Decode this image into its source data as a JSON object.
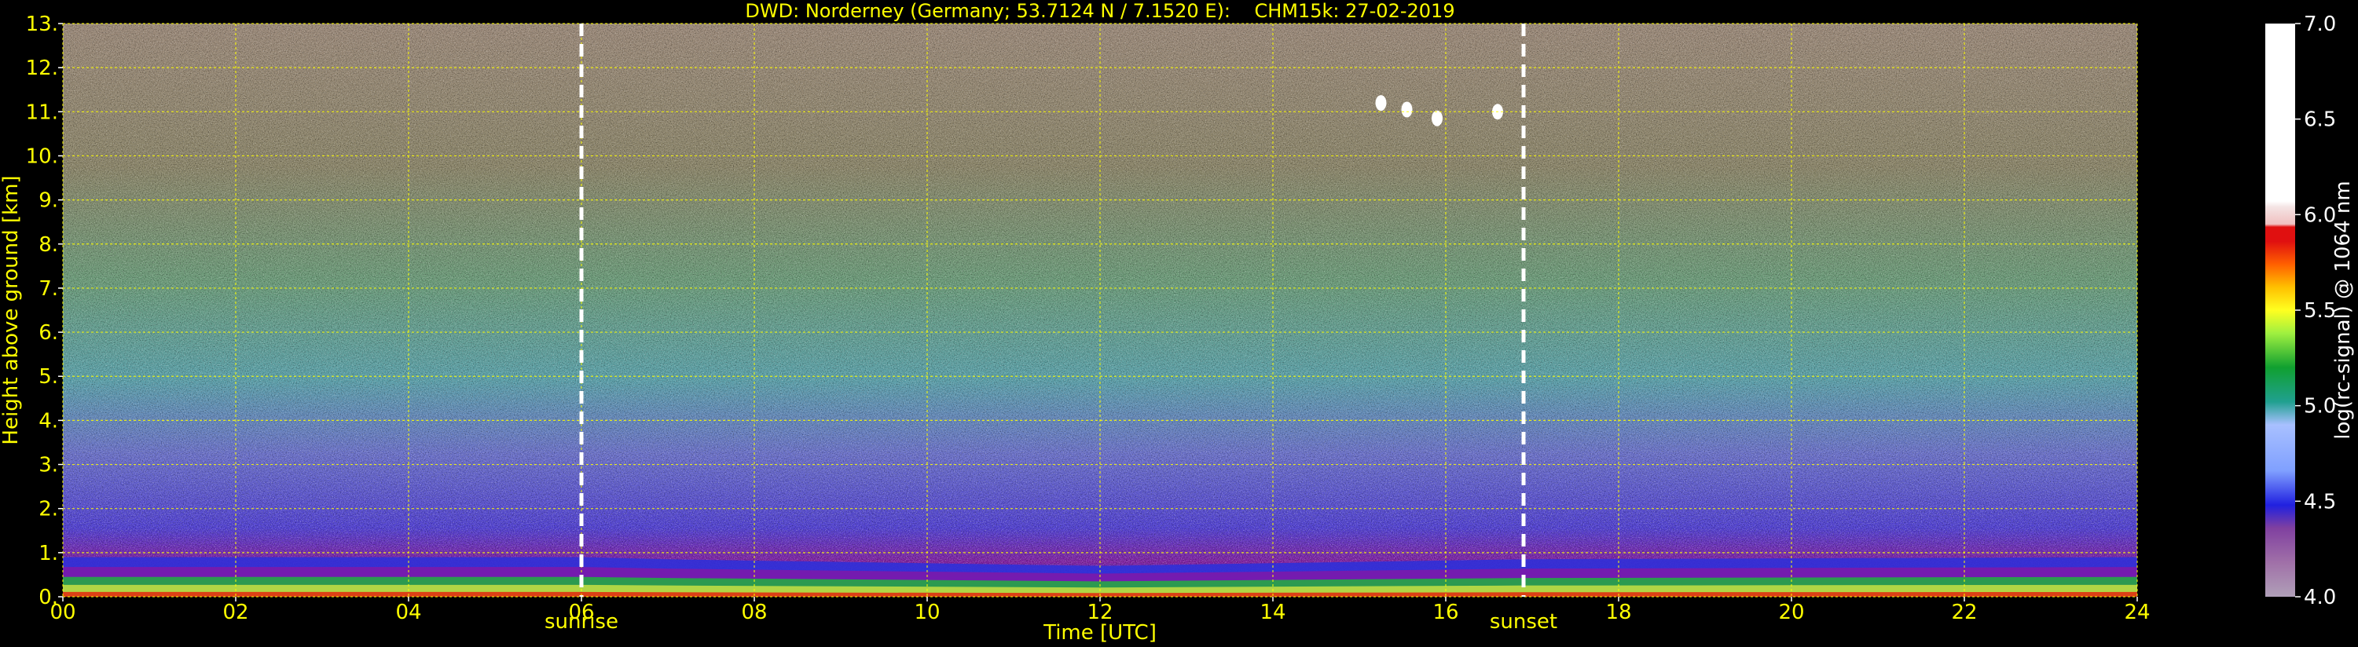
{
  "chart_data": {
    "type": "heatmap",
    "title": "DWD: Norderney (Germany; 53.7124 N / 7.1520 E):    CHM15k: 27-02-2019",
    "xlabel": "Time [UTC]",
    "ylabel": "Height above ground [km]",
    "xlim": [
      0,
      24
    ],
    "ylim": [
      0,
      13
    ],
    "x_ticks": [
      "00",
      "02",
      "04",
      "06",
      "08",
      "10",
      "12",
      "14",
      "16",
      "18",
      "20",
      "22",
      "24"
    ],
    "y_ticks": [
      "0.",
      "1.",
      "2.",
      "3.",
      "4.",
      "5.",
      "6.",
      "7.",
      "8.",
      "9.",
      "10.",
      "11.",
      "12.",
      "13."
    ],
    "grid": true,
    "annotations": [
      {
        "label": "sunrise",
        "x": 6.0
      },
      {
        "label": "sunset",
        "x": 16.9
      }
    ],
    "colorbar": {
      "label": "log(rc-signal) @ 1064 nm",
      "range": [
        4.0,
        7.0
      ],
      "ticks": [
        "4.0",
        "4.5",
        "5.0",
        "5.5",
        "6.0",
        "6.5",
        "7.0"
      ]
    },
    "boundary_layer_top_km": [
      {
        "x": 0,
        "y": 0.9
      },
      {
        "x": 6,
        "y": 0.9
      },
      {
        "x": 7,
        "y": 0.85
      },
      {
        "x": 12,
        "y": 0.7
      },
      {
        "x": 16.9,
        "y": 0.85
      },
      {
        "x": 24,
        "y": 0.9
      }
    ],
    "cloud_patches": [
      {
        "x": 15.25,
        "y": 11.2
      },
      {
        "x": 15.55,
        "y": 11.05
      },
      {
        "x": 15.9,
        "y": 10.85
      },
      {
        "x": 16.6,
        "y": 11.0
      }
    ]
  },
  "colors": {
    "text": "#ffff00",
    "grid": "#ffff00",
    "background": "#000000",
    "colorscale": [
      "#b0a0b8",
      "#a070a8",
      "#8040a0",
      "#6010a0",
      "#2020e0",
      "#4060f8",
      "#80a0ff",
      "#a8c0ff",
      "#20a090",
      "#10a030",
      "#40d040",
      "#a0f040",
      "#ffff20",
      "#ffc000",
      "#ff6000",
      "#ff2010",
      "#e01010",
      "#f0c0c0",
      "#ffffff"
    ]
  }
}
